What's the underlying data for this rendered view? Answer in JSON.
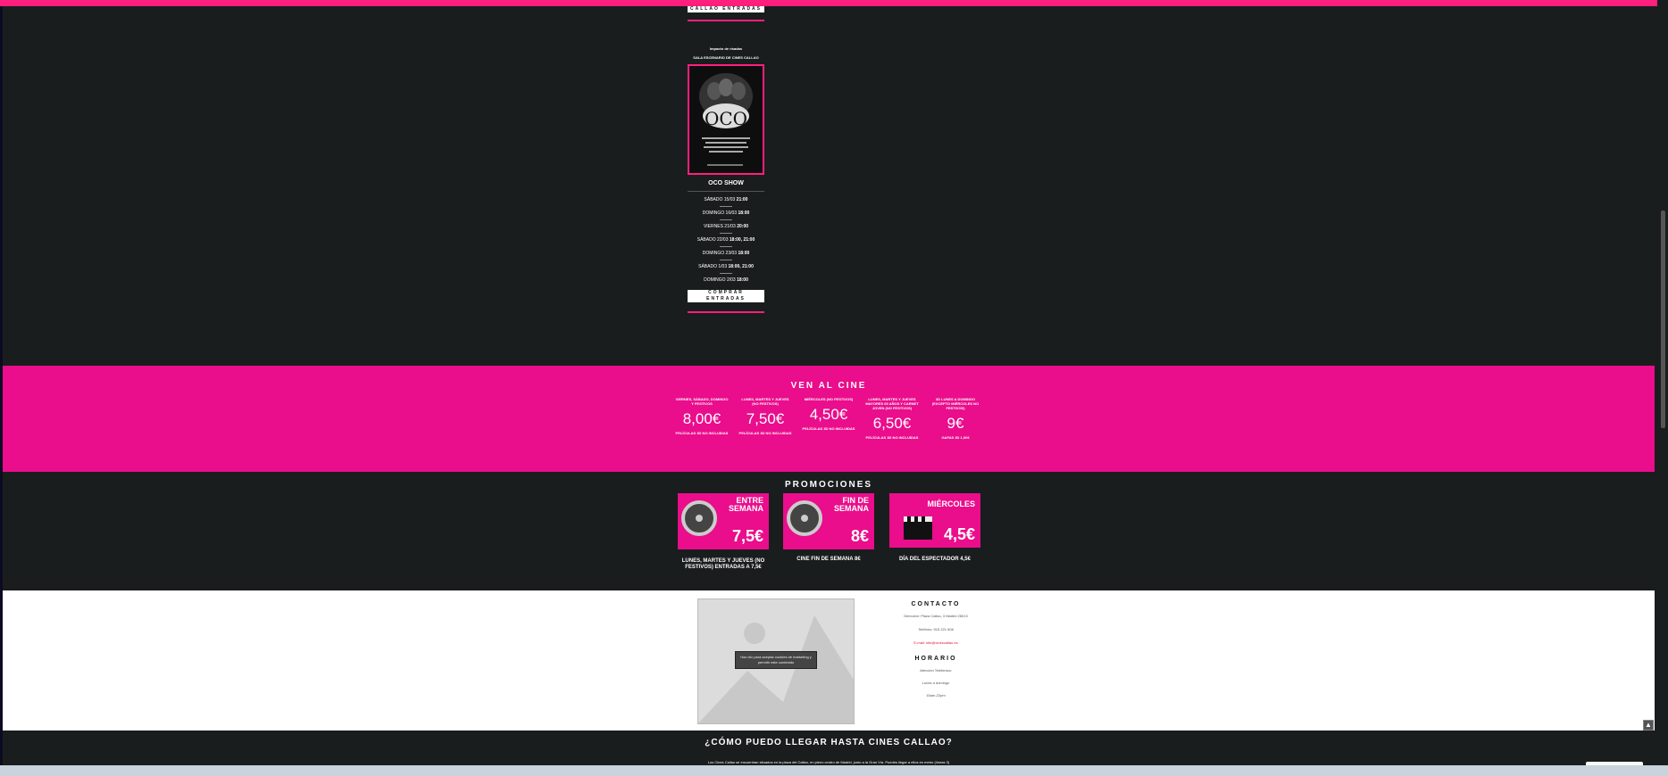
{
  "top_button": {
    "label": "CALLAO ENTRADAS"
  },
  "show": {
    "tiny_line1": "Impacto de risadas",
    "tiny_line2": "SALA ESCENARIO DE CINES CALLAO",
    "poster_title": "OCO",
    "title": "OCO SHOW",
    "dates": [
      {
        "day": "SÁBADO 15/03",
        "time": "21:00"
      },
      {
        "day": "DOMINGO 16/03",
        "time": "18:00"
      },
      {
        "day": "VIERNES 21/03",
        "time": "20:00"
      },
      {
        "day": "SÁBADO 22/03",
        "time": "18:00, 21:00"
      },
      {
        "day": "DOMINGO 23/03",
        "time": "18:00"
      },
      {
        "day": "SÁBADO 1/03",
        "time": "18:00, 21:00"
      },
      {
        "day": "DOMINGO 2/03",
        "time": "18:00"
      }
    ],
    "buy_label": "COMPRAR ENTRADAS"
  },
  "ven": {
    "title": "VEN AL CINE",
    "prices": [
      {
        "label": "VIERNES, SÁBADO, DOMINGO Y FESTIVOS",
        "price": "8,00€",
        "note": "PELÍCULAS 3D NO INCLUIDAS"
      },
      {
        "label": "LUNES, MARTES Y JUEVES (NO FESTIVOS)",
        "price": "7,50€",
        "note": "PELÍCULAS 3D NO INCLUIDAS"
      },
      {
        "label": "MIÉRCOLES (NO FESTIVOS)",
        "price": "4,50€",
        "note": "PELÍCULAS 3D NO INCLUIDAS"
      },
      {
        "label": "LUNES, MARTES Y JUEVES MAYORES 65 AÑOS Y CARNET JOVEN (NO FESTIVOS)",
        "price": "6,50€",
        "note": "PELÍCULAS 3D NO INCLUIDAS"
      },
      {
        "label": "3D LUNES A DOMINGO (EXCEPTO MIÉRCOLES NO FESTIVOS)",
        "price": "9€",
        "note": "GAFAS 3D 1,00€"
      }
    ]
  },
  "promo": {
    "title": "PROMOCIONES",
    "cards": [
      {
        "head": "ENTRE SEMANA",
        "big": "7,5€",
        "caption": "LUNES, MARTES Y JUEVES (NO FESTIVOS) ENTRADAS A 7,5€"
      },
      {
        "head": "FIN DE SEMANA",
        "big": "8€",
        "caption": "CINE FIN DE SEMANA 8€"
      },
      {
        "head": "MIÉRCOLES",
        "big": "4,5€",
        "caption": "DÍA DEL ESPECTADOR 4,5€"
      }
    ]
  },
  "contact": {
    "map_button": "Haz clic para aceptar cookies de marketing y permitir este contenido",
    "title": "CONTACTO",
    "address": "Dirección: Plaza Callao, 3 Madrid 28013",
    "phone": "Teléfono: 915 221 606",
    "email": "E-mail: info@cinescallao.es",
    "hours_title": "HORARIO",
    "hours_1": "Atención Telefónica:",
    "hours_2": "Lunes a domingo",
    "hours_3": "16am-22pm"
  },
  "llegar": {
    "title": "¿CÓMO PUEDO LLEGAR HASTA CINES CALLAO?",
    "text": "Los Cines Callao se encuentran situados en la plaza del Callao, en pleno centro de Madrid, junto a la Gran Vía. Puedes llegar a ellos en metro (líneas 3)"
  },
  "colors": {
    "accent": "#ea0d8c",
    "dark": "#1a1d1d"
  }
}
